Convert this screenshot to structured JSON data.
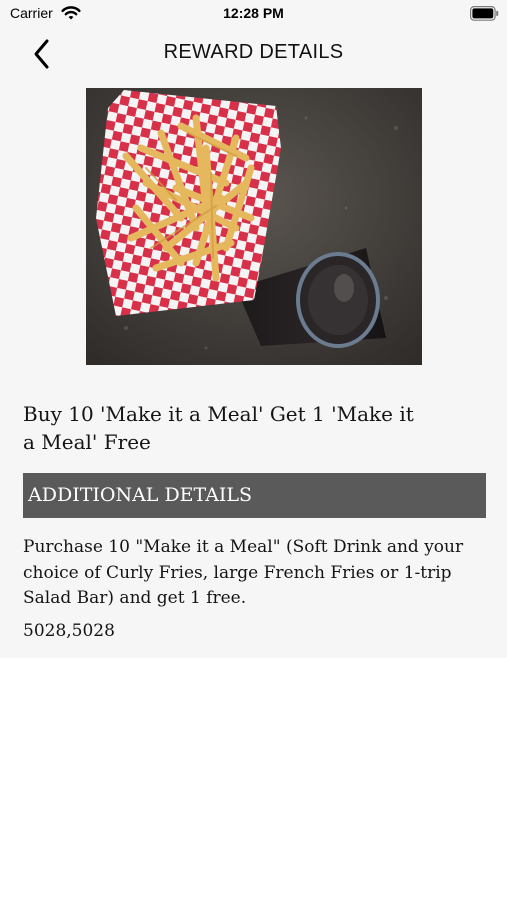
{
  "status_bar": {
    "carrier": "Carrier",
    "time": "12:28 PM",
    "wifi_icon": "wifi-icon",
    "battery_icon": "battery-icon"
  },
  "nav": {
    "back_icon": "chevron-left-icon",
    "title": "REWARD DETAILS"
  },
  "reward": {
    "image": "fries-and-drink-photo",
    "title": "Buy 10 'Make it a Meal' Get 1 'Make it a Meal' Free",
    "section_header": "ADDITIONAL DETAILS",
    "description": "Purchase 10 \"Make it a Meal\" (Soft Drink and your choice of Curly Fries, large French Fries or 1-trip Salad Bar) and get 1 free.",
    "codes": "5028,5028"
  },
  "colors": {
    "background": "#f6f6f6",
    "section_header_bg": "#5a5a5a",
    "section_header_text": "#ffffff"
  }
}
